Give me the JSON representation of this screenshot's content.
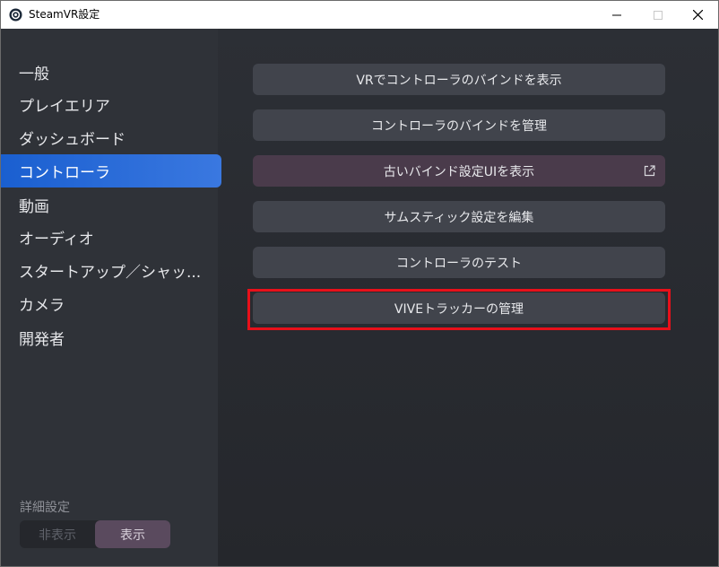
{
  "window": {
    "title": "SteamVR設定",
    "controls": {
      "minimize": "minimize",
      "maximize": "maximize",
      "close": "close"
    }
  },
  "sidebar": {
    "items": [
      {
        "label": "一般"
      },
      {
        "label": "プレイエリア"
      },
      {
        "label": "ダッシュボード"
      },
      {
        "label": "コントローラ",
        "active": true
      },
      {
        "label": "動画"
      },
      {
        "label": "オーディオ"
      },
      {
        "label": "スタートアップ／シャッ..."
      },
      {
        "label": "カメラ"
      },
      {
        "label": "開発者"
      }
    ],
    "advanced_label": "詳細設定",
    "toggle": {
      "hide": "非表示",
      "show": "表示",
      "selected": "表示"
    }
  },
  "main": {
    "buttons": [
      {
        "label": "VRでコントローラのバインドを表示"
      },
      {
        "label": "コントローラのバインドを管理"
      },
      {
        "label": "古いバインド設定UIを表示",
        "icon": "external-link-icon"
      },
      {
        "label": "サムスティック設定を編集"
      },
      {
        "label": "コントローラのテスト"
      },
      {
        "label": "VIVEトラッカーの管理",
        "highlighted": true
      }
    ]
  },
  "colors": {
    "active_nav": "#2a6ad8",
    "highlight_border": "#e8101a",
    "button": "#41444c",
    "button_purple": "#4a3b4b"
  }
}
